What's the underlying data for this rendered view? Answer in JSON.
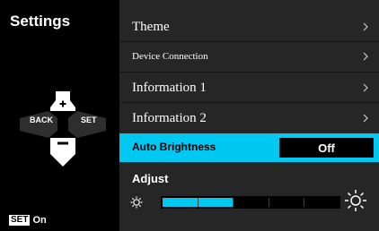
{
  "sidebar": {
    "title": "Settings",
    "back_label": "BACK",
    "set_label": "SET",
    "status_badge": "SET",
    "status_text": "On"
  },
  "menu": {
    "items": [
      {
        "label": "Theme",
        "icon": "chevron-right-icon"
      },
      {
        "label": "Device Connection",
        "icon": "chevron-right-icon"
      },
      {
        "label": "Information 1",
        "icon": "chevron-right-icon"
      },
      {
        "label": "Information 2",
        "icon": "chevron-right-icon"
      }
    ],
    "auto_brightness": {
      "label": "Auto Brightness",
      "value": "Off"
    },
    "adjust": {
      "label": "Adjust",
      "level": 0.4,
      "segments": 5
    }
  },
  "colors": {
    "accent": "#00c8f0",
    "menu_bg": "#262626",
    "background": "#000000"
  },
  "icons": {
    "dpad": "dpad-icon",
    "brightness_low": "sun-low-icon",
    "brightness_high": "sun-high-icon"
  }
}
